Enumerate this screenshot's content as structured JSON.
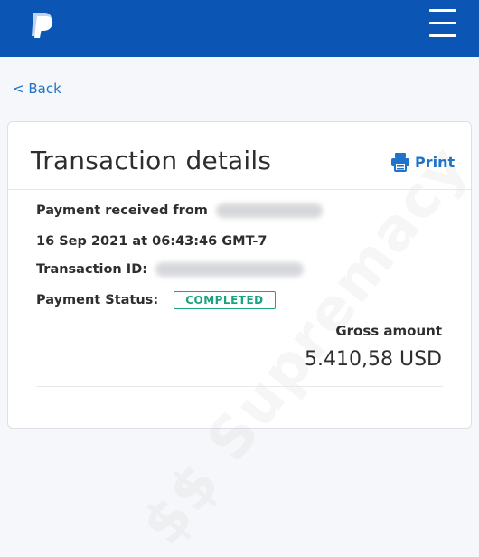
{
  "header": {
    "logo_icon": "paypal-logo-icon",
    "menu_icon": "hamburger-menu-icon",
    "brand_color": "#0b55b5"
  },
  "nav": {
    "back_label": "< Back"
  },
  "card": {
    "title": "Transaction details",
    "print_label": "Print",
    "print_icon": "printer-icon",
    "payment_received_label": "Payment received from",
    "date_time": "16 Sep 2021 at 06:43:46 GMT-7",
    "transaction_id_label": "Transaction ID:",
    "payment_status_label": "Payment Status:",
    "payment_status_value": "COMPLETED",
    "gross_amount_label": "Gross amount",
    "gross_amount_value": "5.410,58 USD"
  },
  "colors": {
    "link": "#1f73c8",
    "status_completed": "#18a47d",
    "text": "#2c2e2f"
  }
}
